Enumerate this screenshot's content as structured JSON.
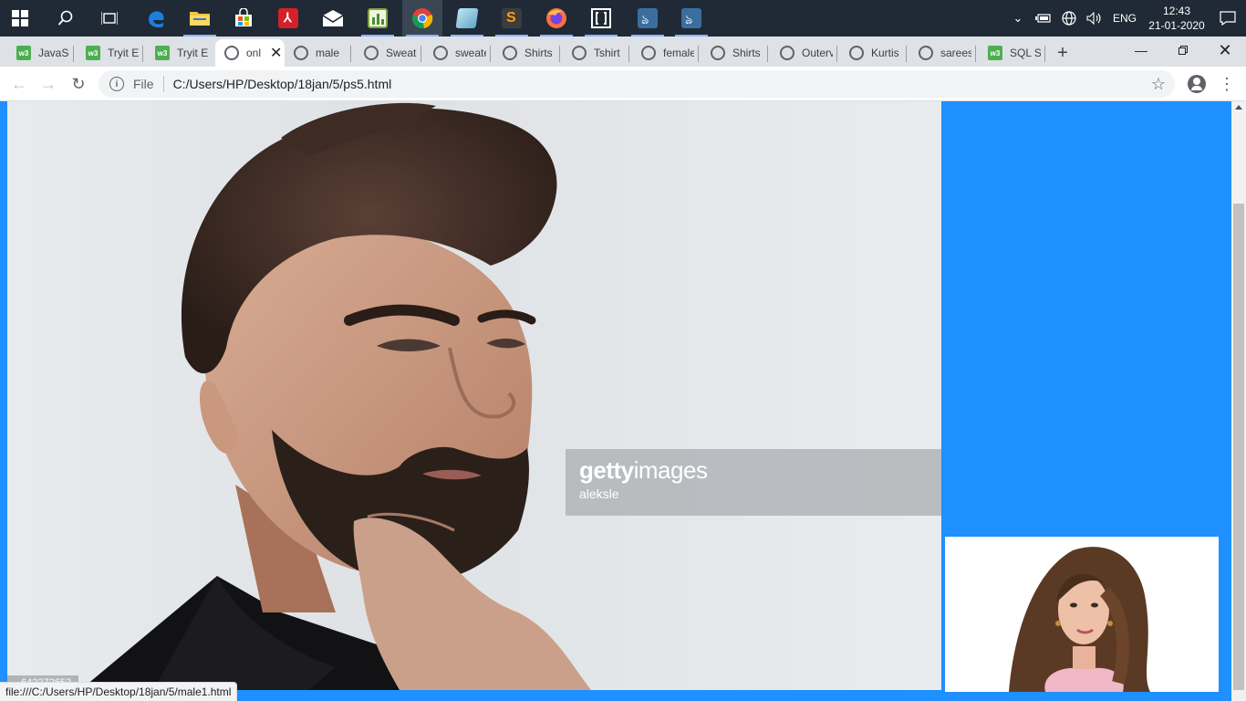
{
  "taskbar": {
    "apps": [
      {
        "name": "start",
        "icon": "windows-logo-icon"
      },
      {
        "name": "search",
        "icon": "search-icon"
      },
      {
        "name": "task-view",
        "icon": "task-view-icon"
      },
      {
        "name": "edge",
        "icon": "edge-icon"
      },
      {
        "name": "file-explorer",
        "icon": "folder-icon"
      },
      {
        "name": "store",
        "icon": "store-icon"
      },
      {
        "name": "acrobat",
        "icon": "acrobat-icon"
      },
      {
        "name": "mail",
        "icon": "mail-icon"
      },
      {
        "name": "chart-app",
        "icon": "chart-app-icon"
      },
      {
        "name": "chrome",
        "icon": "chrome-icon"
      },
      {
        "name": "notepad",
        "icon": "notepad-icon"
      },
      {
        "name": "sublime",
        "icon": "sublime-icon"
      },
      {
        "name": "firefox",
        "icon": "firefox-icon"
      },
      {
        "name": "app-bracket",
        "icon": "bracket-app-icon"
      },
      {
        "name": "mysql-1",
        "icon": "mysql-icon"
      },
      {
        "name": "mysql-2",
        "icon": "mysql-icon"
      }
    ],
    "tray": {
      "language": "ENG",
      "time": "12:43",
      "date": "21-01-2020"
    }
  },
  "browser": {
    "tabs": [
      {
        "title": "JavaSc",
        "favicon": "w3"
      },
      {
        "title": "Tryit Ec",
        "favicon": "w3"
      },
      {
        "title": "Tryit Ec",
        "favicon": "w3"
      },
      {
        "title": "onl",
        "favicon": "globe",
        "active": true
      },
      {
        "title": "male",
        "favicon": "globe"
      },
      {
        "title": "Sweate",
        "favicon": "globe"
      },
      {
        "title": "sweate",
        "favicon": "globe"
      },
      {
        "title": "Shirts",
        "favicon": "globe"
      },
      {
        "title": "Tshirt",
        "favicon": "globe"
      },
      {
        "title": "female",
        "favicon": "globe"
      },
      {
        "title": "Shirts c",
        "favicon": "globe"
      },
      {
        "title": "Outerv",
        "favicon": "globe"
      },
      {
        "title": "Kurtis",
        "favicon": "globe"
      },
      {
        "title": "sarees",
        "favicon": "globe"
      },
      {
        "title": "SQL SE",
        "favicon": "w3"
      }
    ],
    "address": {
      "scheme_label": "File",
      "url": "C:/Users/HP/Desktop/18jan/5/ps5.html"
    },
    "status_url": "file:///C:/Users/HP/Desktop/18jan/5/male1.html"
  },
  "page": {
    "watermark_brand_bold": "getty",
    "watermark_brand_rest": "images",
    "watermark_credit": "aleksle",
    "photo_id": "642272652",
    "colors": {
      "background": "#1e90ff"
    }
  }
}
